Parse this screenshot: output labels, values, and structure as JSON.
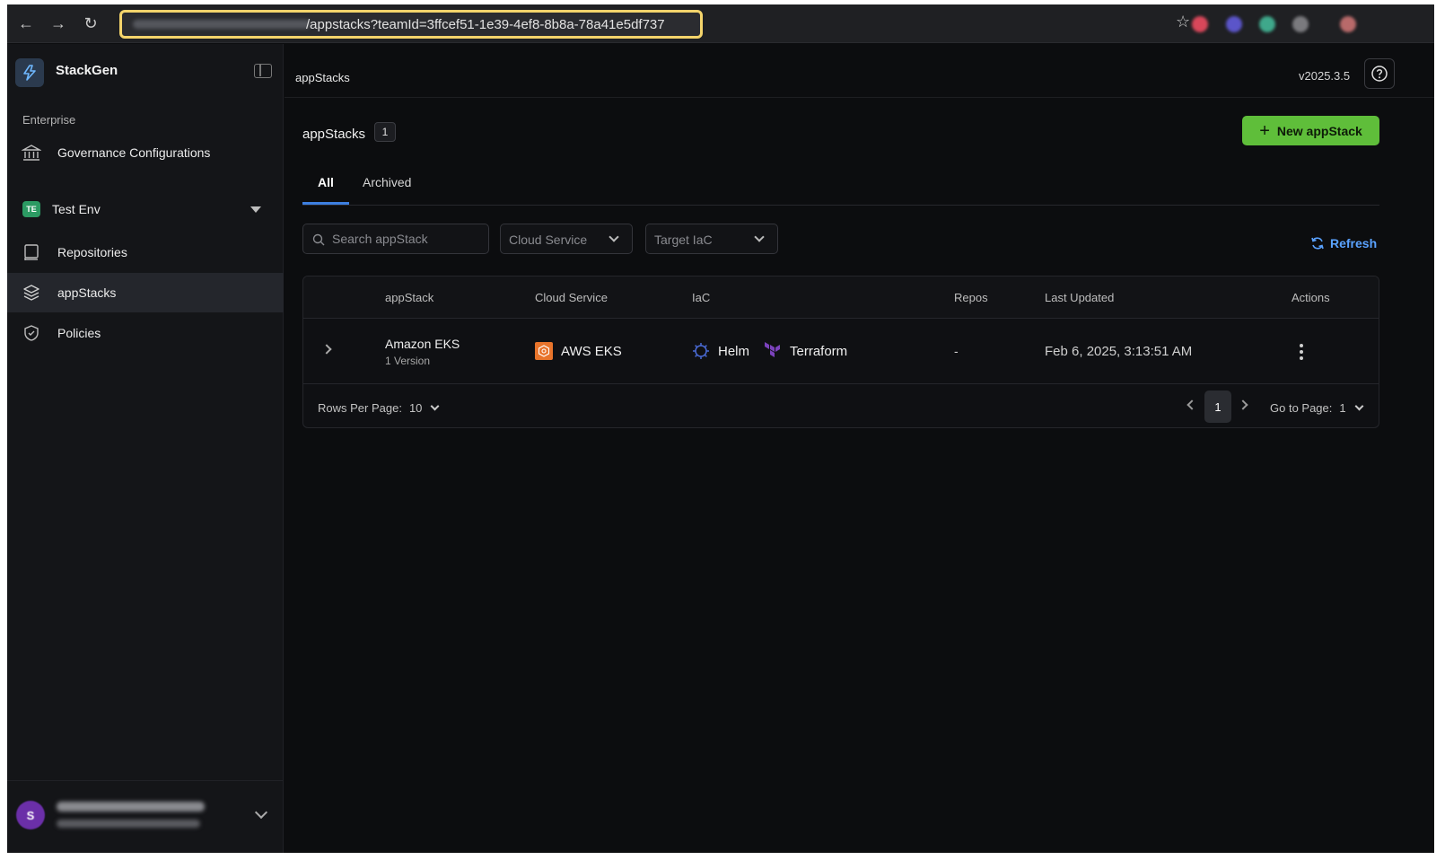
{
  "browser": {
    "url_visible": "/appstacks?teamId=3ffcef51-1e39-4ef8-8b8a-78a41e5df737"
  },
  "sidebar": {
    "brand": "StackGen",
    "section_label": "Enterprise",
    "governance_label": "Governance Configurations",
    "environment": {
      "badge": "TE",
      "label": "Test Env"
    },
    "items": [
      {
        "label": "Repositories",
        "icon": "repository-icon"
      },
      {
        "label": "appStacks",
        "icon": "layers-icon",
        "active": true
      },
      {
        "label": "Policies",
        "icon": "shield-icon"
      }
    ],
    "user": {
      "initial": "S"
    }
  },
  "header": {
    "breadcrumb": "appStacks",
    "version": "v2025.3.5"
  },
  "main": {
    "title": "appStacks",
    "count": "1",
    "new_button": "New appStack",
    "tabs": [
      {
        "label": "All",
        "active": true
      },
      {
        "label": "Archived",
        "active": false
      }
    ],
    "search_placeholder": "Search appStack",
    "filters": {
      "cloud_service": "Cloud Service",
      "target_iac": "Target IaC"
    },
    "refresh_label": "Refresh"
  },
  "table": {
    "columns": [
      "appStack",
      "Cloud Service",
      "IaC",
      "Repos",
      "Last Updated",
      "Actions"
    ],
    "rows": [
      {
        "name": "Amazon EKS",
        "version": "1 Version",
        "cloud_service": "AWS EKS",
        "iac": [
          "Helm",
          "Terraform"
        ],
        "repos": "-",
        "last_updated": "Feb 6, 2025, 3:13:51 AM"
      }
    ],
    "footer": {
      "rows_per_page_label": "Rows Per Page:",
      "rows_per_page_value": "10",
      "current_page": "1",
      "goto_label": "Go to Page:",
      "goto_value": "1"
    }
  },
  "colors": {
    "accent_green": "#5fbe3a",
    "link_blue": "#5aa2ff",
    "tab_underline": "#3d7fe0",
    "aws_orange": "#e8742b",
    "terraform_purple": "#7b42bc"
  }
}
